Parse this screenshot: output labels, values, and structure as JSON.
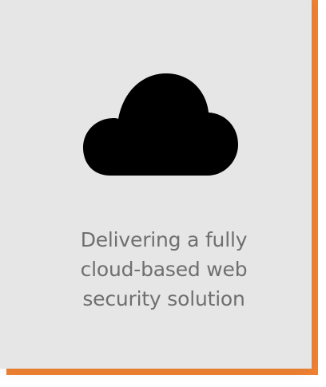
{
  "card": {
    "icon": "cloud-icon",
    "text_lines": [
      "Delivering a fully",
      "cloud-based web",
      "security solution"
    ]
  },
  "colors": {
    "accent": "#f08232",
    "card_background": "#e6e6e6",
    "icon": "#000000",
    "text": "#6f6f6f"
  }
}
